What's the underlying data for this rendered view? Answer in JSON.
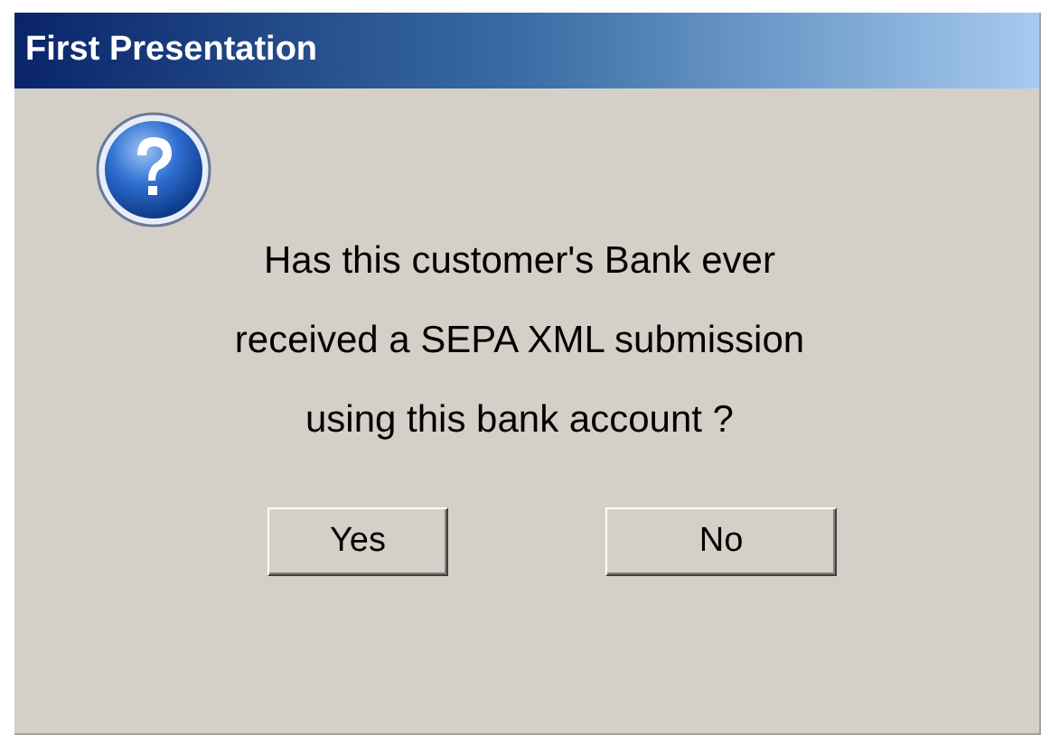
{
  "window": {
    "title": "First Presentation"
  },
  "message": [
    "Has this customer's Bank ever",
    "received a SEPA XML submission",
    "using this bank account ?"
  ],
  "buttons": [
    {
      "label": "Yes"
    },
    {
      "label": "No"
    }
  ]
}
